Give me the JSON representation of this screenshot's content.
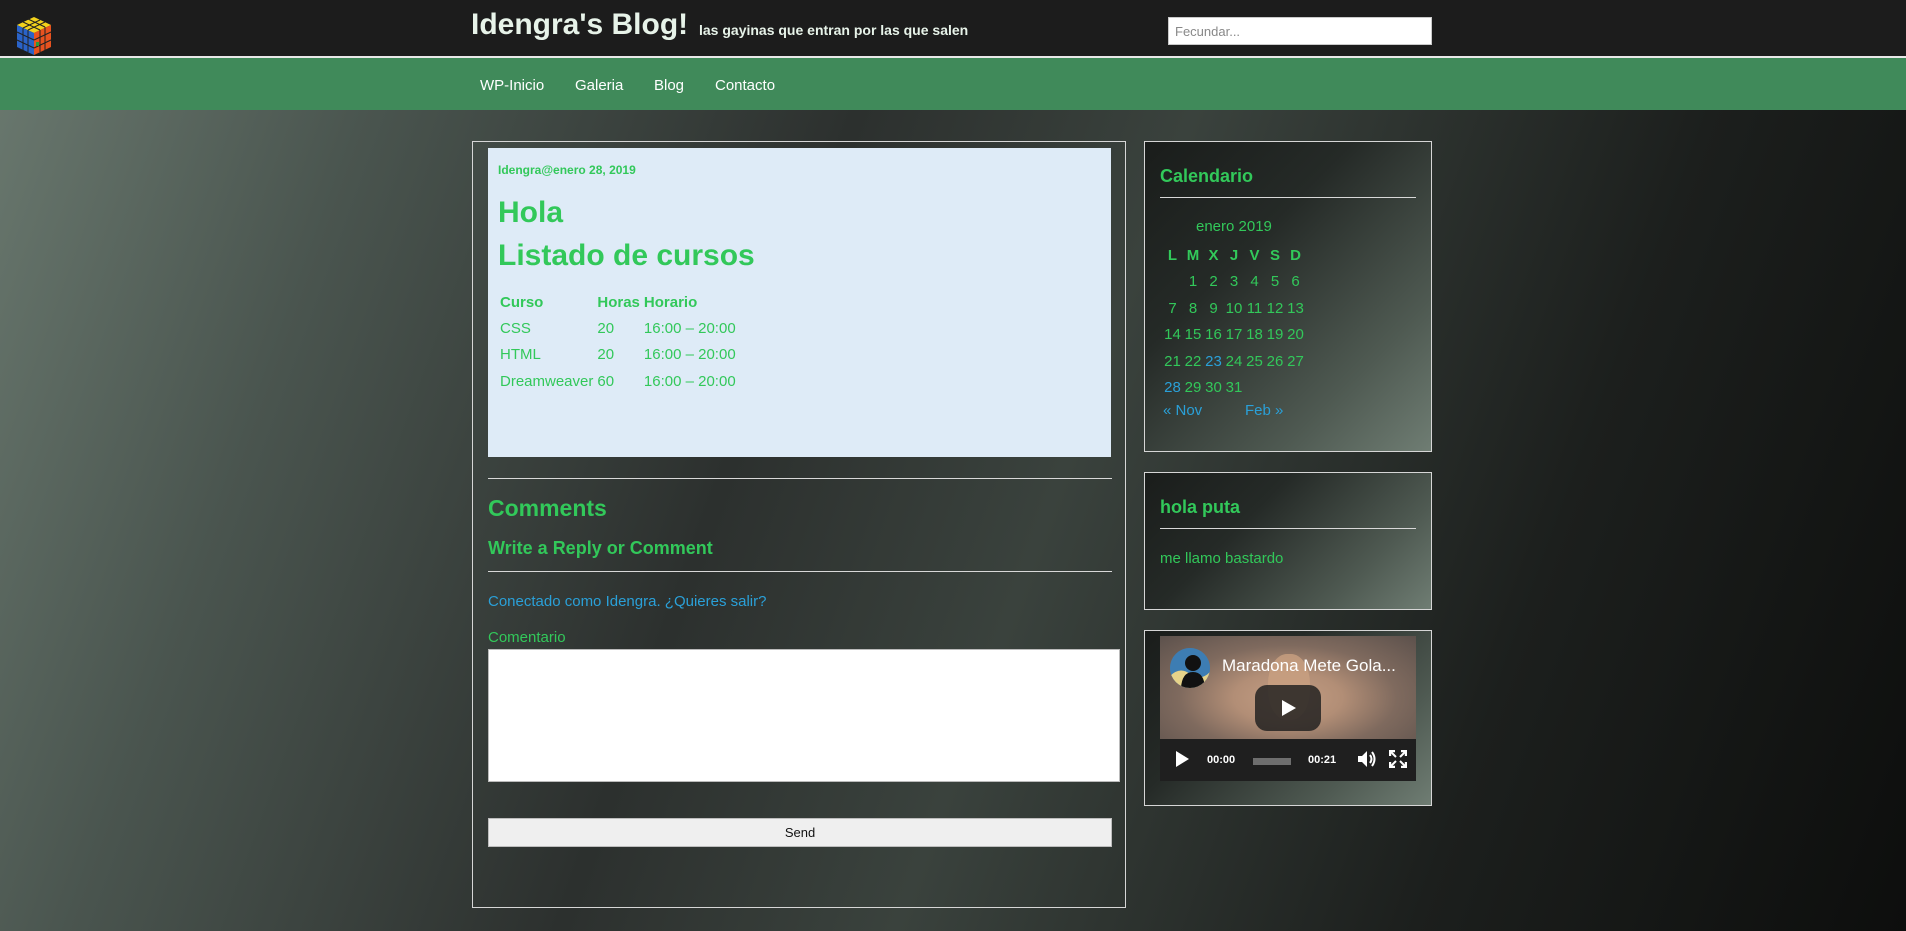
{
  "header": {
    "site_title": "Idengra's Blog!",
    "tagline": "las gayinas que entran por las que salen",
    "search_placeholder": "Fecundar..."
  },
  "nav": {
    "items": [
      {
        "label": "WP-Inicio"
      },
      {
        "label": "Galeria"
      },
      {
        "label": "Blog"
      },
      {
        "label": "Contacto"
      }
    ]
  },
  "post": {
    "meta": "Idengra@enero 28, 2019",
    "title": "Hola",
    "subtitle": "Listado de cursos",
    "table": {
      "headers": [
        "Curso",
        "Horas",
        "Horario"
      ],
      "rows": [
        [
          "CSS",
          "20",
          "16:00 – 20:00"
        ],
        [
          "HTML",
          "20",
          "16:00 – 20:00"
        ],
        [
          "Dreamweaver",
          "60",
          "16:00 – 20:00"
        ]
      ]
    }
  },
  "comments": {
    "heading": "Comments",
    "reply_heading": "Write a Reply or Comment",
    "logged_in_text": "Conectado como Idengra. ¿Quieres salir?",
    "comment_label": "Comentario",
    "comment_value": "",
    "send_label": "Send"
  },
  "sidebar": {
    "calendar": {
      "title": "Calendario",
      "caption": "enero 2019",
      "weekdays": [
        "L",
        "M",
        "X",
        "J",
        "V",
        "S",
        "D"
      ],
      "weeks": [
        [
          "",
          "1",
          "2",
          "3",
          "4",
          "5",
          "6"
        ],
        [
          "7",
          "8",
          "9",
          "10",
          "11",
          "12",
          "13"
        ],
        [
          "14",
          "15",
          "16",
          "17",
          "18",
          "19",
          "20"
        ],
        [
          "21",
          "22",
          "23",
          "24",
          "25",
          "26",
          "27"
        ],
        [
          "28",
          "29",
          "30",
          "31",
          "",
          "",
          ""
        ]
      ],
      "linked_days": [
        "23",
        "28"
      ],
      "prev_label": "« Nov",
      "next_label": "Feb »"
    },
    "text_widget": {
      "title": "hola puta",
      "body": "me llamo bastardo"
    },
    "video": {
      "title": "Maradona Mete Gola...",
      "current_time": "00:00",
      "duration": "00:21"
    }
  },
  "colors": {
    "accent_green": "#32c85a",
    "nav_green": "#408a5a",
    "link_blue": "#2aa0d8",
    "post_bg": "#deebf7"
  }
}
